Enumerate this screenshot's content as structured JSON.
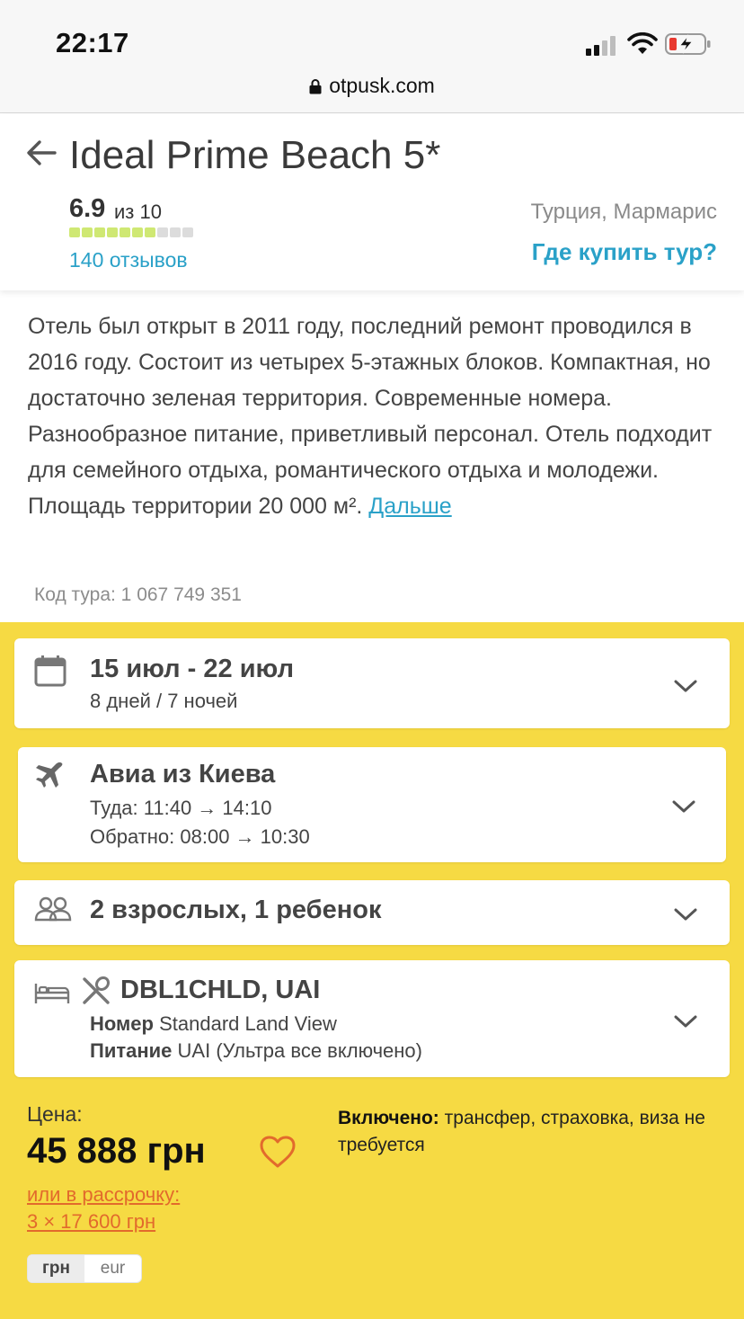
{
  "status_bar": {
    "time": "22:17",
    "icons": [
      "cellular-signal-icon",
      "wifi-icon",
      "battery-low-charging-icon"
    ]
  },
  "browser": {
    "url": "otpusk.com",
    "icon": "lock-icon"
  },
  "hotel": {
    "title": "Ideal Prime Beach 5*",
    "rating": "6.9",
    "rating_suffix": "из 10",
    "rating_fill": 0.69,
    "reviews": "140 отзывов",
    "location": "Турция, Мармарис",
    "where_to_buy": "Где купить тур?"
  },
  "description": {
    "text": "Отель был открыт в 2011 году, последний ремонт проводился в 2016 году. Состоит из четырех 5-этажных блоков. Компактная, но достаточно зеленая территория. Современные номера. Разнообразное питание, приветливый персонал. Отель подходит для семейного отдыха, романтического отдыха и молодежи. Площадь территории 20 000 м².",
    "more_link": "Дальше"
  },
  "tour_code": "Код тура: 1 067 749 351",
  "cards": {
    "dates": {
      "title": "15 июл - 22 июл",
      "subtitle": "8 дней / 7 ночей",
      "icon": "calendar-icon"
    },
    "flight": {
      "title": "Авиа из Киева",
      "outbound": "Туда: 11:40 → 14:10",
      "return": "Обратно: 08:00 → 10:30",
      "icon": "airplane-icon"
    },
    "guests": {
      "title": "2 взрослых, 1 ребенок",
      "icon": "people-icon"
    },
    "room": {
      "title": "DBL1CHLD, UAI",
      "room_label": "Номер",
      "room_value": "Standard Land View",
      "meal_label": "Питание",
      "meal_value": "UAI (Ультра все включено)",
      "icons": [
        "bed-icon",
        "fork-knife-icon"
      ]
    }
  },
  "price": {
    "label": "Цена:",
    "value": "45 888 грн",
    "installment_line1": "или в рассрочку:",
    "installment_line2": "3 × 17 600 грн",
    "included_label": "Включено:",
    "included_text": "трансфер, страховка, виза не требуется"
  },
  "currency": {
    "options": [
      "грн",
      "eur"
    ],
    "selected": "грн"
  },
  "colors": {
    "accent_blue": "#2aa1c8",
    "accent_yellow": "#f6da43",
    "installment_orange": "#e26a2c",
    "rating_green": "#cfe873"
  }
}
